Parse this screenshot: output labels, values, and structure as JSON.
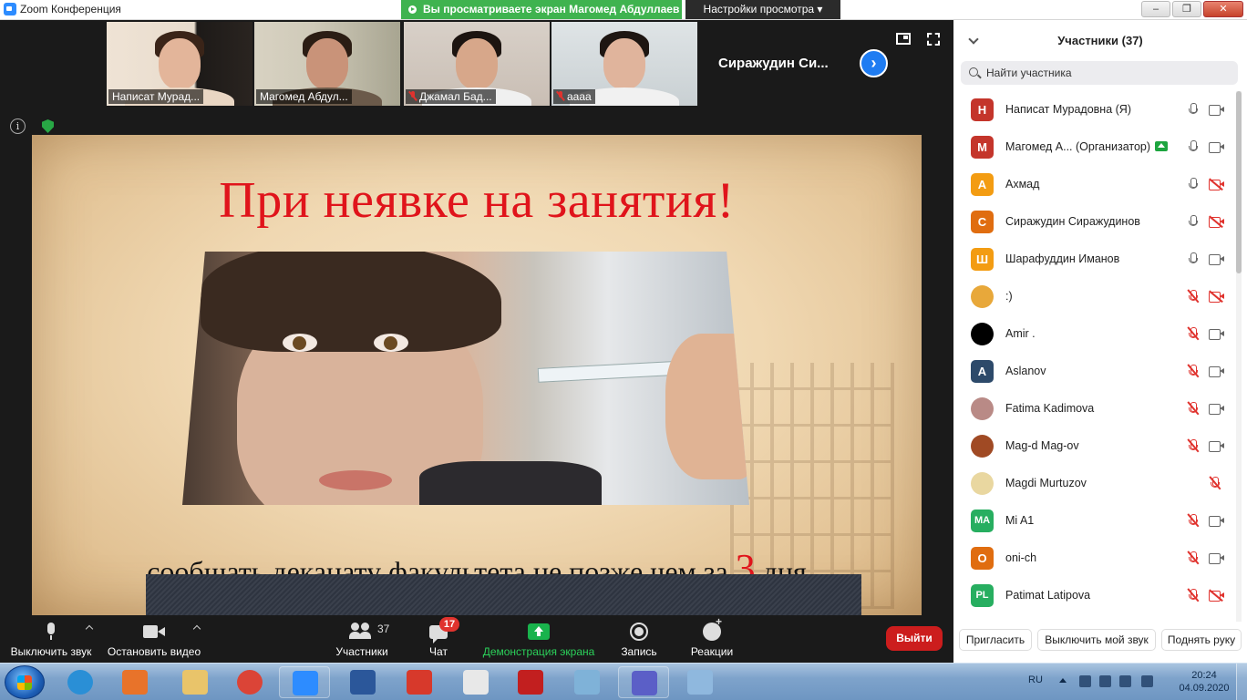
{
  "window": {
    "title": "Zoom Конференция",
    "share_banner": "Вы просматриваете экран Магомед Абдуллаев",
    "view_options": "Настройки просмотра ▾",
    "minimize": "–",
    "maximize": "❐",
    "close": "✕"
  },
  "video_strip": {
    "tiles": [
      {
        "name": "Написат Мурад...",
        "muted": false
      },
      {
        "name": "Магомед Абдул...",
        "muted": false,
        "active": true
      },
      {
        "name": "Джамал Бад...",
        "muted": true
      },
      {
        "name": "аааа",
        "muted": true
      }
    ],
    "name_only_tile": "Сиражудин  Си...",
    "next_arrow": "›"
  },
  "slide": {
    "title": "При неявке на занятия!",
    "subtitle_prefix": "сообщать деканату факультета не позже чем за ",
    "subtitle_number": "3",
    "subtitle_suffix": " дня"
  },
  "info_icon": "i",
  "participants": {
    "title": "Участники (37)",
    "search_placeholder": "Найти участника",
    "list": [
      {
        "initial": "Н",
        "color": "#c4352b",
        "name": "Написат Мурадовна (Я)",
        "mic_muted": false,
        "cam_off": false
      },
      {
        "initial": "М",
        "color": "#c4352b",
        "name": "Магомед А...  (Организатор)",
        "host": true,
        "mic_muted": false,
        "cam_off": false
      },
      {
        "initial": "А",
        "color": "#f39c12",
        "name": "Ахмад",
        "mic_muted": false,
        "cam_off": true
      },
      {
        "initial": "С",
        "color": "#e06d10",
        "name": "Сиражудин Сиражудинов",
        "mic_muted": false,
        "cam_off": true
      },
      {
        "initial": "Ш",
        "color": "#f39c12",
        "name": "Шарафуддин Иманов",
        "mic_muted": false,
        "cam_off": false
      },
      {
        "initial": "",
        "color": "#e8a83a",
        "name": ":)",
        "mic_muted": true,
        "cam_off": true
      },
      {
        "initial": "",
        "color": "#000000",
        "name": "Amir .",
        "mic_muted": true,
        "cam_off": false
      },
      {
        "initial": "A",
        "color": "#2d4a6a",
        "name": "Aslanov",
        "mic_muted": true,
        "cam_off": false
      },
      {
        "initial": "",
        "color": "#b98a86",
        "name": "Fatima Kadimova",
        "mic_muted": true,
        "cam_off": false
      },
      {
        "initial": "",
        "color": "#a04a24",
        "name": "Mag-d Mag-ov",
        "mic_muted": true,
        "cam_off": false
      },
      {
        "initial": "",
        "color": "#e9d7a0",
        "name": "Magdi Murtuzov",
        "mic_muted": true,
        "cam_off": null
      },
      {
        "initial": "MA",
        "color": "#27ae60",
        "name": "Mi A1",
        "mic_muted": true,
        "cam_off": false
      },
      {
        "initial": "O",
        "color": "#e06d10",
        "name": "oni-ch",
        "mic_muted": true,
        "cam_off": false
      },
      {
        "initial": "PL",
        "color": "#27ae60",
        "name": "Patimat Latipova",
        "mic_muted": true,
        "cam_off": true
      }
    ],
    "invite": "Пригласить",
    "mute_me": "Выключить мой звук",
    "raise_hand": "Поднять руку"
  },
  "toolbar": {
    "mute": "Выключить звук",
    "stop_video": "Остановить видео",
    "participants": "Участники",
    "participants_count": "37",
    "chat": "Чат",
    "chat_badge": "17",
    "share": "Демонстрация экрана",
    "record": "Запись",
    "reactions": "Реакции",
    "leave": "Выйти"
  },
  "taskbar": {
    "apps": [
      {
        "icon": "internet-explorer-icon",
        "color": "#2a8fd6"
      },
      {
        "icon": "media-player-icon",
        "color": "#e8732a"
      },
      {
        "icon": "file-explorer-icon",
        "color": "#e9c46a"
      },
      {
        "icon": "chrome-icon",
        "color": "#db4437"
      },
      {
        "icon": "zoom-icon",
        "color": "#2d8cff"
      },
      {
        "icon": "word-icon",
        "color": "#2b579a"
      },
      {
        "icon": "pdf-reader-icon",
        "color": "#d7392b"
      },
      {
        "icon": "yandex-browser-icon",
        "color": "#e8e8e8"
      },
      {
        "icon": "acrobat-icon",
        "color": "#c21f1f"
      },
      {
        "icon": "notepad-icon",
        "color": "#7fb2d8"
      },
      {
        "icon": "teams-icon",
        "color": "#5b5fc7"
      },
      {
        "icon": "paint-icon",
        "color": "#8fb8de"
      }
    ],
    "language": "RU",
    "time": "20:24",
    "date": "04.09.2020"
  }
}
